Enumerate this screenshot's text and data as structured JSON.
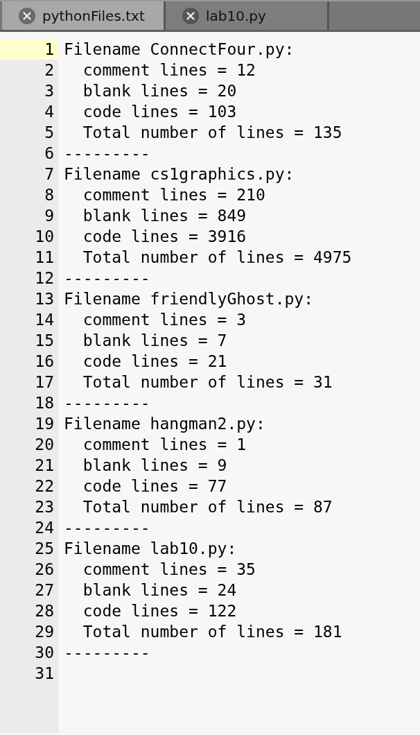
{
  "tabs": [
    {
      "label": "pythonFiles.txt",
      "selected": true
    },
    {
      "label": "lab10.py",
      "selected": false
    }
  ],
  "editor": {
    "lines": [
      {
        "number": "1",
        "text": "Filename ConnectFour.py:",
        "current": true
      },
      {
        "number": "2",
        "text": "  comment lines = 12",
        "current": false
      },
      {
        "number": "3",
        "text": "  blank lines = 20",
        "current": false
      },
      {
        "number": "4",
        "text": "  code lines = 103",
        "current": false
      },
      {
        "number": "5",
        "text": "  Total number of lines = 135",
        "current": false
      },
      {
        "number": "6",
        "text": "---------",
        "current": false
      },
      {
        "number": "7",
        "text": "Filename cs1graphics.py:",
        "current": false
      },
      {
        "number": "8",
        "text": "  comment lines = 210",
        "current": false
      },
      {
        "number": "9",
        "text": "  blank lines = 849",
        "current": false
      },
      {
        "number": "10",
        "text": "  code lines = 3916",
        "current": false
      },
      {
        "number": "11",
        "text": "  Total number of lines = 4975",
        "current": false
      },
      {
        "number": "12",
        "text": "---------",
        "current": false
      },
      {
        "number": "13",
        "text": "Filename friendlyGhost.py:",
        "current": false
      },
      {
        "number": "14",
        "text": "  comment lines = 3",
        "current": false
      },
      {
        "number": "15",
        "text": "  blank lines = 7",
        "current": false
      },
      {
        "number": "16",
        "text": "  code lines = 21",
        "current": false
      },
      {
        "number": "17",
        "text": "  Total number of lines = 31",
        "current": false
      },
      {
        "number": "18",
        "text": "---------",
        "current": false
      },
      {
        "number": "19",
        "text": "Filename hangman2.py:",
        "current": false
      },
      {
        "number": "20",
        "text": "  comment lines = 1",
        "current": false
      },
      {
        "number": "21",
        "text": "  blank lines = 9",
        "current": false
      },
      {
        "number": "22",
        "text": "  code lines = 77",
        "current": false
      },
      {
        "number": "23",
        "text": "  Total number of lines = 87",
        "current": false
      },
      {
        "number": "24",
        "text": "---------",
        "current": false
      },
      {
        "number": "25",
        "text": "Filename lab10.py:",
        "current": false
      },
      {
        "number": "26",
        "text": "  comment lines = 35",
        "current": false
      },
      {
        "number": "27",
        "text": "  blank lines = 24",
        "current": false
      },
      {
        "number": "28",
        "text": "  code lines = 122",
        "current": false
      },
      {
        "number": "29",
        "text": "  Total number of lines = 181",
        "current": false
      },
      {
        "number": "30",
        "text": "---------",
        "current": false
      },
      {
        "number": "31",
        "current": false
      }
    ]
  }
}
